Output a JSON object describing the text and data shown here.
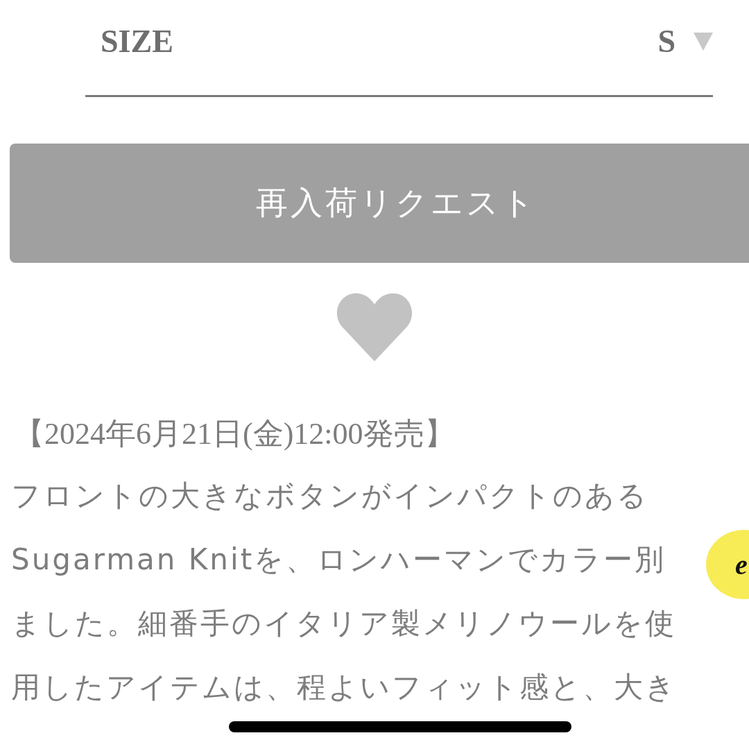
{
  "size_select": {
    "label": "SIZE",
    "value": "S"
  },
  "restock_button": {
    "label": "再入荷リクエスト"
  },
  "description": {
    "release": "【2024年6月21日(金)12:00発売】",
    "lines": [
      "フロントの大きなボタンがインパクトのある",
      "Sugarman Knitを、ロンハーマンでカラー別",
      "ました。細番手のイタリア製メリノウールを使",
      "用したアイテムは、程よいフィット感と、大き"
    ]
  },
  "floating_badge": {
    "label": "e"
  }
}
